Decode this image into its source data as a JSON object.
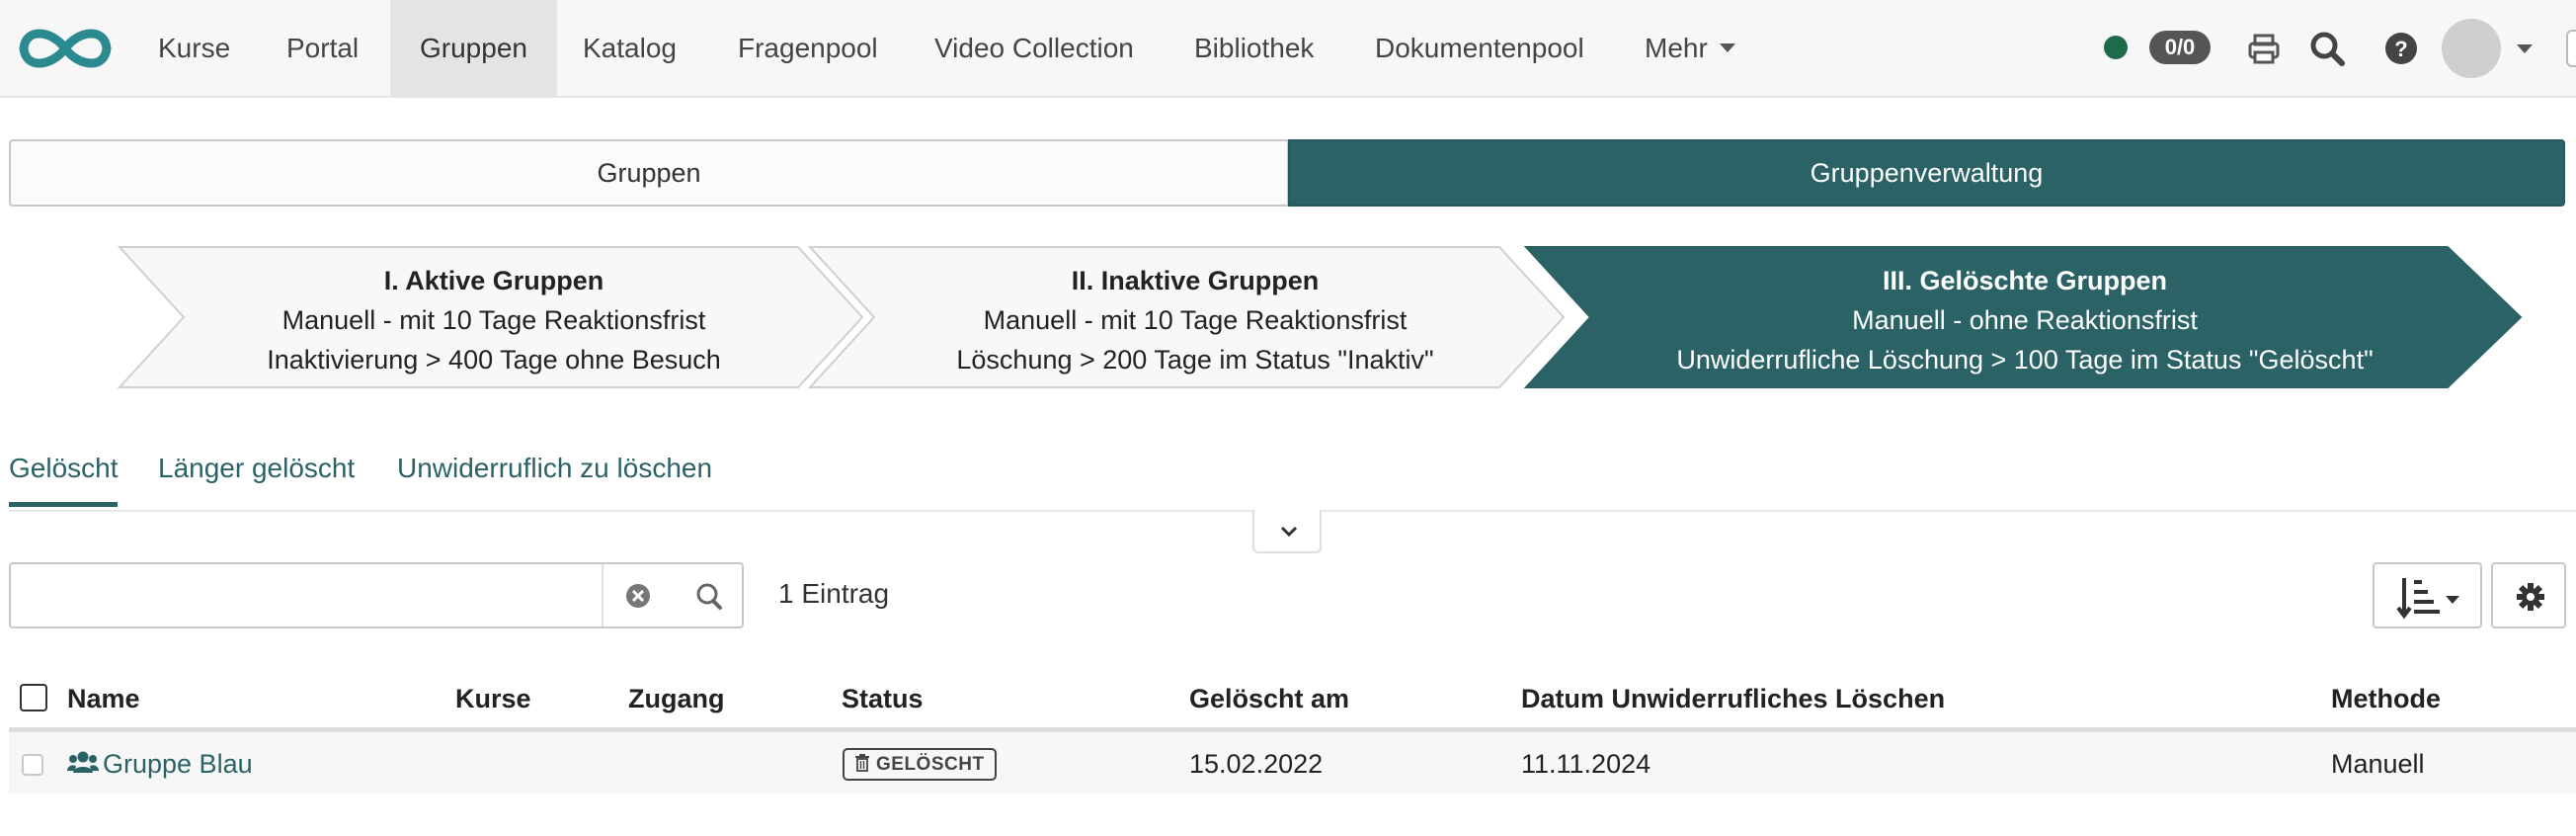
{
  "nav": {
    "items": [
      {
        "label": "Kurse",
        "active": false
      },
      {
        "label": "Portal",
        "active": false
      },
      {
        "label": "Gruppen",
        "active": true
      },
      {
        "label": "Katalog",
        "active": false
      },
      {
        "label": "Fragenpool",
        "active": false
      },
      {
        "label": "Video Collection",
        "active": false
      },
      {
        "label": "Bibliothek",
        "active": false
      },
      {
        "label": "Dokumentenpool",
        "active": false
      }
    ],
    "more_label": "Mehr",
    "badge": "0/0",
    "icons": [
      "print-icon",
      "search-icon",
      "help-icon"
    ]
  },
  "segments": {
    "left": "Gruppen",
    "right": "Gruppenverwaltung"
  },
  "steps": [
    {
      "title": "I. Aktive Gruppen",
      "line1": "Manuell - mit 10 Tage Reaktionsfrist",
      "line2": "Inaktivierung > 400 Tage ohne Besuch",
      "active": false
    },
    {
      "title": "II. Inaktive Gruppen",
      "line1": "Manuell - mit 10 Tage Reaktionsfrist",
      "line2": "Löschung > 200 Tage im Status \"Inaktiv\"",
      "active": false
    },
    {
      "title": "III. Gelöschte Gruppen",
      "line1": "Manuell - ohne Reaktionsfrist",
      "line2": "Unwiderrufliche Löschung > 100 Tage im Status \"Gelöscht\"",
      "active": true
    }
  ],
  "subtabs": [
    "Gelöscht",
    "Länger gelöscht",
    "Unwiderruflich zu löschen"
  ],
  "search": {
    "value": "",
    "placeholder": ""
  },
  "count_label": "1 Eintrag",
  "table": {
    "headers": {
      "name": "Name",
      "kurse": "Kurse",
      "zugang": "Zugang",
      "status": "Status",
      "geloescht_am": "Gelöscht am",
      "datum_loeschen": "Datum Unwiderrufliches Löschen",
      "methode": "Methode"
    },
    "rows": [
      {
        "name": "Gruppe Blau",
        "kurse": "",
        "zugang": "",
        "status": "GELÖSCHT",
        "geloescht_am": "15.02.2022",
        "datum_loeschen": "11.11.2024",
        "methode": "Manuell"
      }
    ]
  },
  "colors": {
    "accent": "#2b6266",
    "status_online": "#1e6b4b",
    "badge_bg": "#555555"
  }
}
